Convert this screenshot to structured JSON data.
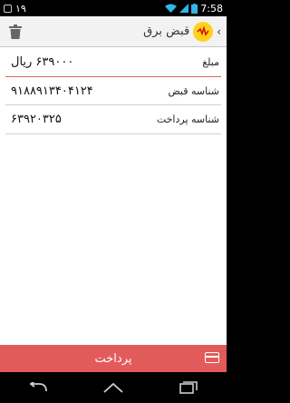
{
  "status_bar": {
    "left_number": "۱۹",
    "time": "7:58"
  },
  "action_bar": {
    "title": "قبض برق",
    "back_icon": "chevron-left-icon",
    "logo_icon": "electricity-logo-icon",
    "delete_icon": "trash-icon"
  },
  "bill": {
    "amount_label": "مبلغ",
    "amount_value": "۶۳۹۰۰۰ ریال",
    "bill_id_label": "شناسه قبض",
    "bill_id_value": "۹۱۸۸۹۱۳۴۰۴۱۲۴",
    "payment_id_label": "شناسه پرداخت",
    "payment_id_value": "۶۳۹۲۰۳۲۵"
  },
  "pay_button": {
    "label": "پرداخت",
    "icon": "credit-card-icon"
  },
  "colors": {
    "accent_red": "#e25b5b",
    "divider_red": "#e06666",
    "logo_yellow": "#ffd21a"
  }
}
